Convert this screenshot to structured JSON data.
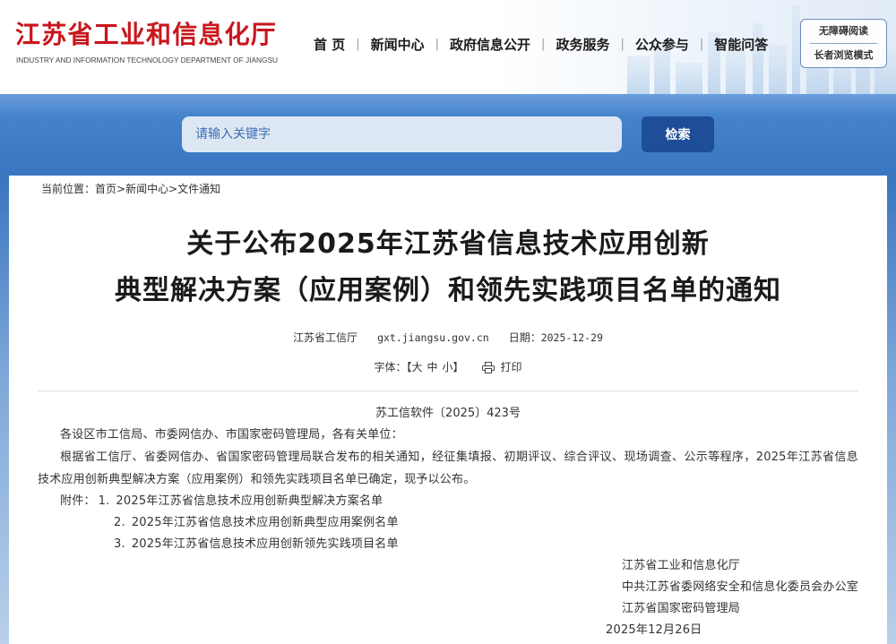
{
  "header": {
    "logo_cn": "江苏省工业和信息化厅",
    "logo_en": "INDUSTRY AND INFORMATION TECHNOLOGY DEPARTMENT OF JIANGSU",
    "nav_separator": "|",
    "nav": [
      {
        "label": "首 页"
      },
      {
        "label": "新闻中心"
      },
      {
        "label": "政府信息公开"
      },
      {
        "label": "政务服务"
      },
      {
        "label": "公众参与"
      },
      {
        "label": "智能问答"
      }
    ],
    "accessibility": {
      "barrier_free_label": "无障碍阅读",
      "elder_mode_label": "长者浏览模式"
    }
  },
  "search": {
    "value": "",
    "placeholder": "请输入关键字",
    "button_label": "检索"
  },
  "breadcrumb": {
    "prefix": "当前位置：",
    "separator": ">",
    "items": [
      "首页",
      "新闻中心",
      "文件通知"
    ]
  },
  "article": {
    "title_lines": [
      "关于公布2025年江苏省信息技术应用创新",
      "典型解决方案（应用案例）和领先实践项目名单的通知"
    ],
    "source": "江苏省工信厅",
    "site": "gxt.jiangsu.gov.cn",
    "date_label": "日期：",
    "date": "2025-12-29",
    "font_label": "字体：",
    "font_bracket_open": "【",
    "font_sizes": [
      "大",
      "中",
      "小"
    ],
    "font_bracket_close": "】",
    "print_label": "打印",
    "doc_number": "苏工信软件〔2025〕423号",
    "salutation": "各设区市工信局、市委网信办、市国家密码管理局，各有关单位：",
    "body": "根据省工信厅、省委网信办、省国家密码管理局联合发布的相关通知，经征集填报、初期评议、综合评议、现场调查、公示等程序，2025年江苏省信息技术应用创新典型解决方案（应用案例）和领先实践项目名单已确定，现予以公布。",
    "attachments_label": "附件：",
    "attachments": [
      {
        "num": "1.",
        "text": "2025年江苏省信息技术应用创新典型解决方案名单"
      },
      {
        "num": "2.",
        "text": "2025年江苏省信息技术应用创新典型应用案例名单"
      },
      {
        "num": "3.",
        "text": "2025年江苏省信息技术应用创新领先实践项目名单"
      }
    ],
    "signatories": [
      "江苏省工业和信息化厅",
      "中共江苏省委网络安全和信息化委员会办公室",
      "江苏省国家密码管理局"
    ],
    "sign_date": "2025年12月26日"
  },
  "icons": {
    "print": "printer-icon"
  },
  "colors": {
    "brand_red": "#c8161d",
    "banner_blue": "#3a75c0",
    "button_blue": "#1e4e98",
    "input_bg": "#dde7f3",
    "placeholder_blue": "#3b6eb2",
    "text": "#333333"
  }
}
